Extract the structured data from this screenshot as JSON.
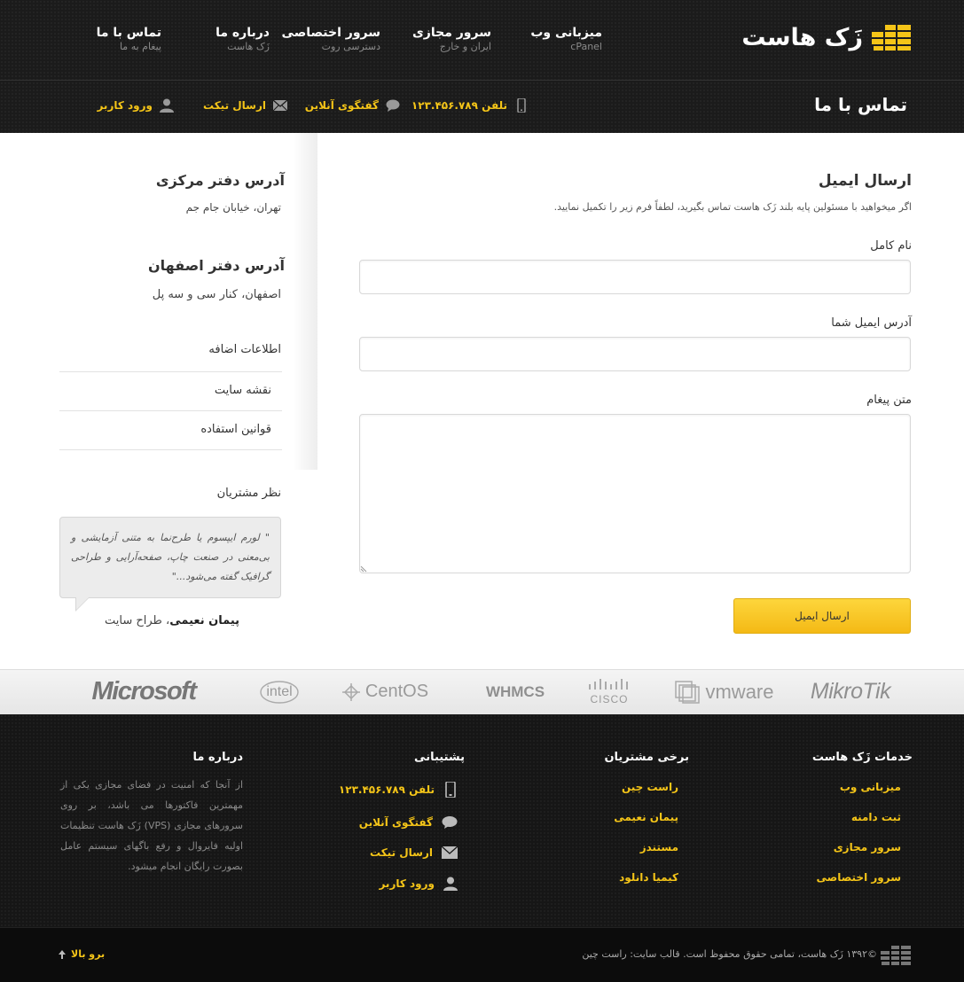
{
  "brand": {
    "name": "زَک هاست",
    "color": "#f5c518",
    "logo_icon": "server-rack-icon"
  },
  "nav": [
    {
      "title": "میزبانی وب",
      "sub": "cPanel"
    },
    {
      "title": "سرور مجازی",
      "sub": "ایران و خارج"
    },
    {
      "title": "سرور اختصاصی",
      "sub": "دسترسی روت"
    },
    {
      "title": "درباره ما",
      "sub": "زَک هاست"
    },
    {
      "title": "تماس با ما",
      "sub": "پیغام به ما"
    }
  ],
  "page_title": "تماس با ما",
  "toolbar": {
    "phone": "تلفن ۱۲۳.۴۵۶.۷۸۹",
    "chat": "گفتگوی آنلاین",
    "ticket": "ارسال تیکت",
    "login": "ورود کاربر"
  },
  "form": {
    "title": "ارسال ایمیل",
    "description": "اگر میخواهید با مسئولین پایه بلند زَک هاست تماس بگیرید، لطفاً فرم زیر را تکمیل نمایید.",
    "name_label": "نام کامل",
    "name_value": "",
    "email_label": "آدرس ایمیل شما",
    "email_value": "",
    "message_label": "متن پیغام",
    "message_value": "",
    "submit_label": "ارسال ایمیل"
  },
  "sidebar": {
    "hq_title": "آدرس دفتر مرکزی",
    "hq_address": "تهران، خیابان جام جم",
    "isfahan_title": "آدرس دفتر اصفهان",
    "isfahan_address": "اصفهان، کنار سی و سه پل",
    "links": [
      "اطلاعات اضافه",
      "نقشه سایت",
      "قوانین استفاده"
    ],
    "testimonials_title": "نظر مشتریان",
    "testimonial_text": "\" لورم ایپسوم یا طرح‌نما به متنی آزمایشی و بی‌معنی در صنعت چاپ، صفحه‌آرایی و طراحی گرافیک گفته می‌شود...\"",
    "author_name": "پیمان نعیمی",
    "author_role": "، طراح سایت"
  },
  "partners": [
    "MikroTik",
    "vmware",
    "CISCO",
    "WHMCS",
    "CentOS",
    "intel",
    "Microsoft"
  ],
  "footer": {
    "services_title": "خدمات زَک هاست",
    "services": [
      "میزبانی وب",
      "ثبت دامنه",
      "سرور مجازی",
      "سرور اختصاصی"
    ],
    "customers_title": "برخی مشتریان",
    "customers": [
      "راست چین",
      "پیمان نعیمی",
      "مستندز",
      "کیمیا دانلود"
    ],
    "support_title": "پشتیبانی",
    "support_phone": "تلفن ۱۲۳.۴۵۶.۷۸۹",
    "support_chat": "گفتگوی آنلاین",
    "support_ticket": "ارسال تیکت",
    "support_login": "ورود کاربر",
    "about_title": "درباره ما",
    "about_text": "از آنجا که امنیت در فضای مجازی یکی از مهمترین فاکتورها می باشد، بر روی سرورهای مجازی (VPS) زَک هاست تنظیمات اولیه فایروال و رفع باگهای سیستم عامل بصورت رایگان انجام میشود."
  },
  "bottom": {
    "copyright": "©۱۳۹۲ زَک هاست، تمامی حقوق محفوظ است. قالب سایت: راست چین",
    "back_to_top": "برو بالا"
  }
}
